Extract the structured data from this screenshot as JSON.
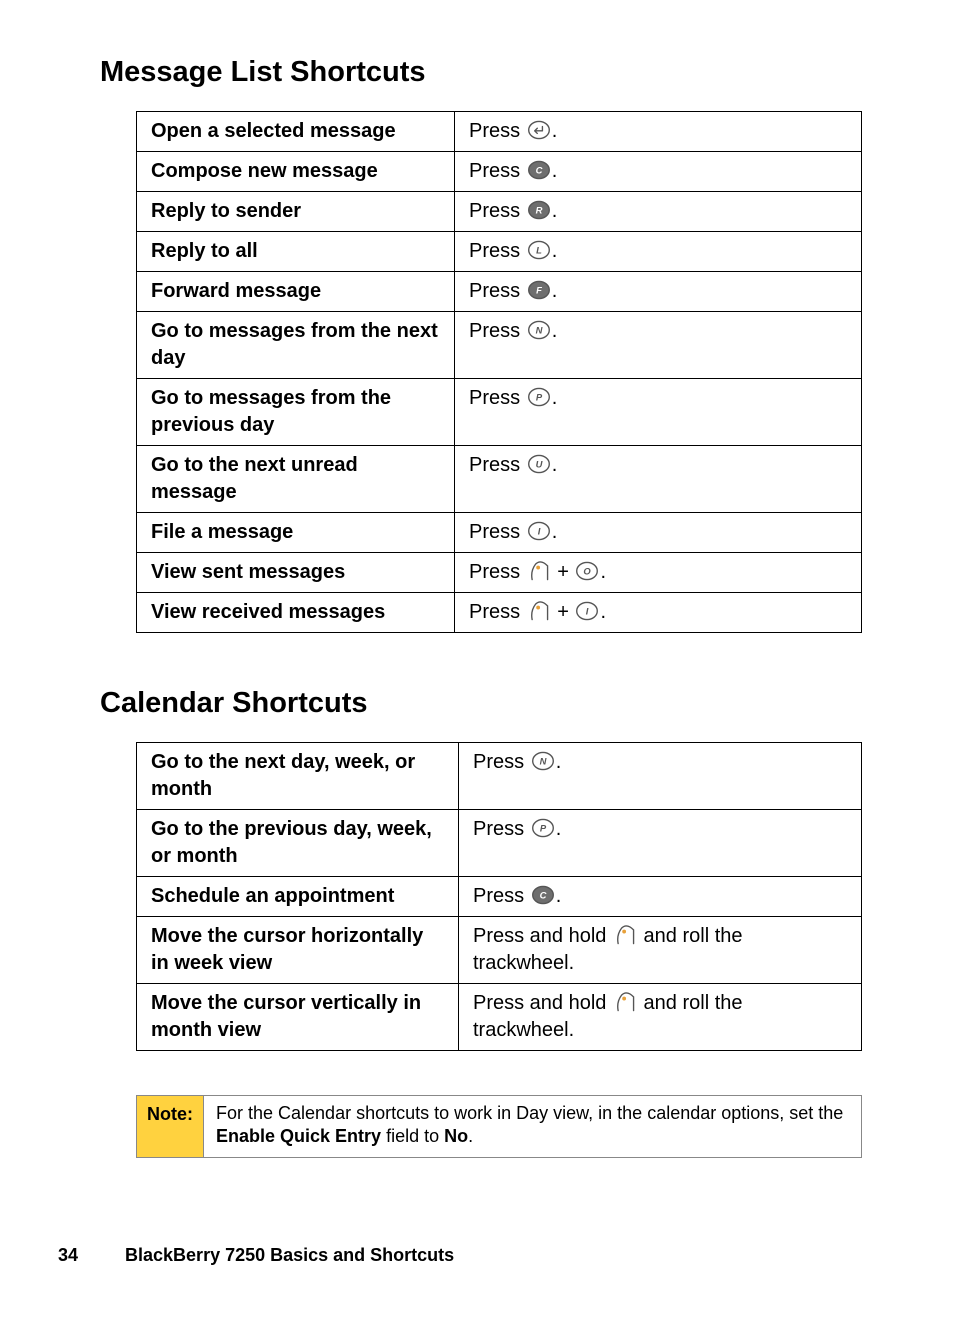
{
  "headings": {
    "message_list": "Message List Shortcuts",
    "calendar": "Calendar Shortcuts"
  },
  "message_rows": [
    {
      "label": "Open a selected message",
      "action_prefix": "Press ",
      "keys": [
        "enter"
      ],
      "action_suffix": "."
    },
    {
      "label": "Compose new message",
      "action_prefix": "Press ",
      "keys": [
        "C"
      ],
      "action_suffix": "."
    },
    {
      "label": "Reply to sender",
      "action_prefix": "Press ",
      "keys": [
        "R"
      ],
      "action_suffix": "."
    },
    {
      "label": "Reply to all",
      "action_prefix": "Press ",
      "keys": [
        "L"
      ],
      "action_suffix": "."
    },
    {
      "label": "Forward message",
      "action_prefix": "Press ",
      "keys": [
        "F"
      ],
      "action_suffix": "."
    },
    {
      "label": "Go to messages from the next day",
      "action_prefix": "Press ",
      "keys": [
        "N"
      ],
      "action_suffix": "."
    },
    {
      "label": "Go to messages from the previous day",
      "action_prefix": "Press ",
      "keys": [
        "P"
      ],
      "action_suffix": "."
    },
    {
      "label": "Go to the next unread message",
      "action_prefix": "Press ",
      "keys": [
        "U"
      ],
      "action_suffix": "."
    },
    {
      "label": "File a message",
      "action_prefix": "Press ",
      "keys": [
        "I"
      ],
      "action_suffix": "."
    },
    {
      "label": "View sent messages",
      "action_prefix": "Press ",
      "keys": [
        "alt",
        "plus",
        "O"
      ],
      "action_suffix": "."
    },
    {
      "label": "View received messages",
      "action_prefix": "Press ",
      "keys": [
        "alt",
        "plus",
        "I"
      ],
      "action_suffix": "."
    }
  ],
  "calendar_rows": [
    {
      "label": "Go to the next day, week, or month",
      "action_prefix": "Press ",
      "keys": [
        "N"
      ],
      "action_suffix": "."
    },
    {
      "label": "Go to the previous day, week, or month",
      "action_prefix": "Press ",
      "keys": [
        "P"
      ],
      "action_suffix": "."
    },
    {
      "label": "Schedule an appointment",
      "action_prefix": "Press ",
      "keys": [
        "C"
      ],
      "action_suffix": "."
    },
    {
      "label": "Move the cursor horizontally in week view",
      "action_prefix": "Press and hold ",
      "keys": [
        "alt"
      ],
      "action_suffix": " and roll the trackwheel."
    },
    {
      "label": "Move the cursor vertically in month view",
      "action_prefix": "Press and hold ",
      "keys": [
        "alt"
      ],
      "action_suffix": " and roll the trackwheel."
    }
  ],
  "note": {
    "tag": "Note:",
    "body_pre": "For the Calendar shortcuts to work in Day view, in the calendar options, set the ",
    "body_bold": "Enable Quick Entry",
    "body_mid": " field to ",
    "body_bold2": "No",
    "body_end": "."
  },
  "footer": {
    "page": "34",
    "title": "BlackBerry 7250 Basics and Shortcuts"
  }
}
